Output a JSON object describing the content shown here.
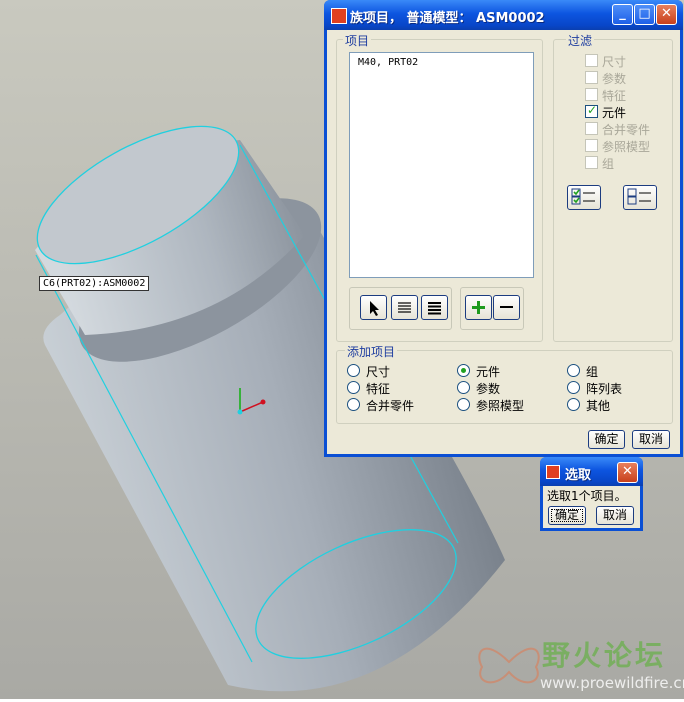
{
  "viewport": {
    "tooltip": "C6(PRT02):ASM0002",
    "watermark": {
      "text": "野火论坛",
      "url": "www.proewildfire.cn"
    }
  },
  "family_dialog": {
    "title": "族项目，    普通模型：  ASM0002",
    "items_group": {
      "label": "项目",
      "items": [
        "M40, PRT02"
      ]
    },
    "filter_group": {
      "label": "过滤",
      "options": [
        {
          "label": "尺寸",
          "checked": false,
          "enabled": false
        },
        {
          "label": "参数",
          "checked": false,
          "enabled": false
        },
        {
          "label": "特征",
          "checked": false,
          "enabled": false
        },
        {
          "label": "元件",
          "checked": true,
          "enabled": true
        },
        {
          "label": "合并零件",
          "checked": false,
          "enabled": false
        },
        {
          "label": "参照模型",
          "checked": false,
          "enabled": false
        },
        {
          "label": "组",
          "checked": false,
          "enabled": false
        }
      ]
    },
    "add_group": {
      "label": "添加项目",
      "options": [
        {
          "label": "尺寸",
          "selected": false
        },
        {
          "label": "元件",
          "selected": true
        },
        {
          "label": "组",
          "selected": false
        },
        {
          "label": "特征",
          "selected": false
        },
        {
          "label": "参数",
          "selected": false
        },
        {
          "label": "阵列表",
          "selected": false
        },
        {
          "label": "合并零件",
          "selected": false
        },
        {
          "label": "参照模型",
          "selected": false
        },
        {
          "label": "其他",
          "selected": false
        }
      ]
    },
    "ok_label": "确定",
    "cancel_label": "取消"
  },
  "select_dialog": {
    "title": "选取",
    "message": "选取1个项目。",
    "ok_label": "确定",
    "cancel_label": "取消"
  },
  "icons": {
    "arrow": "select-arrow-icon",
    "list": "list-icon",
    "table": "table-icon",
    "add": "plus-icon",
    "remove": "minus-icon",
    "check_all": "check-all-icon",
    "uncheck_all": "uncheck-all-icon"
  },
  "colors": {
    "title_bar": "#0a4fd4",
    "dialog_bg": "#ece9d8",
    "highlight_edge": "#20d0e0",
    "model_gray": "#a0a8b2"
  }
}
